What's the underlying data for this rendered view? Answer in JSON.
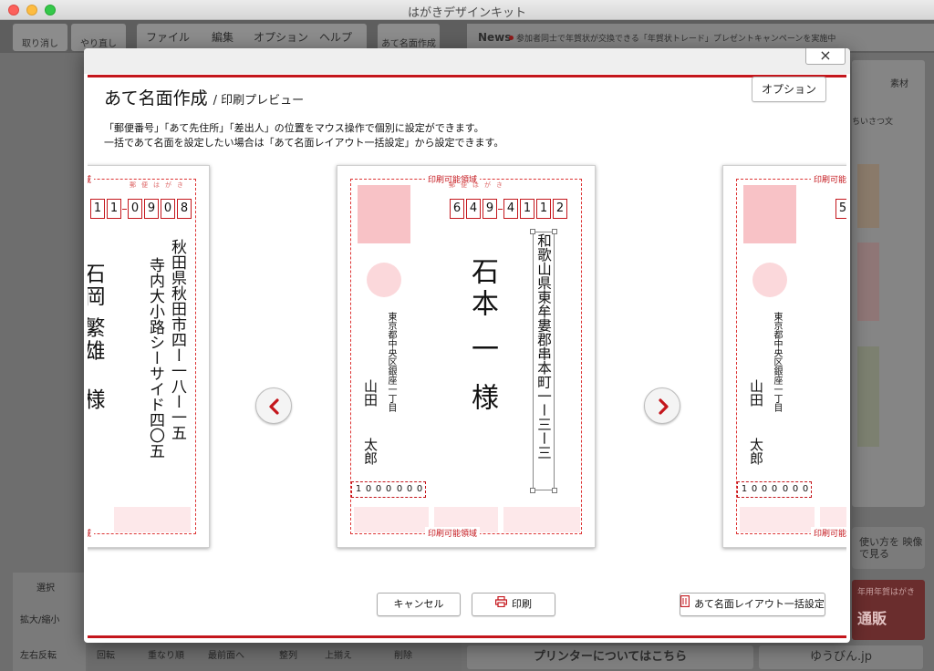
{
  "window": {
    "title": "はがきデザインキット"
  },
  "background": {
    "undo": "取り消し",
    "redo": "やり直し",
    "menu": [
      "ファイル",
      "編集",
      "オプション",
      "ヘルプ"
    ],
    "addr_btn": "あて名面作成",
    "news_label": "News",
    "news_text": "参加者同士で年賀状が交換できる「年賀状トレード」プレゼントキャンペーンを実施中",
    "right_tab": "素材",
    "right_field": "ちいさつ文",
    "cta": "使い方を 映像で見る",
    "ad_text": "年用年賀はがき",
    "ad_big": "通販",
    "select_label": "選択",
    "zoom_label": "拡大/縮小",
    "flip_label": "左右反転",
    "rotate_label": "回転",
    "order_label": "重なり順",
    "front_label": "最前面へ",
    "align_label": "整列",
    "top_align_label": "上揃え",
    "delete_label": "削除",
    "printer_link": "プリンターについてはこちら",
    "yubin": "ゆうびん.jp"
  },
  "dialog": {
    "title": "あて名面作成",
    "subtitle": "/ 印刷プレビュー",
    "option_label": "オプション",
    "desc1": "「郵便番号」「あて先住所」「差出人」の位置をマウス操作で個別に設定ができます。",
    "desc2": "一括であて名面を設定したい場合は「あて名面レイアウト一括設定」から設定できます。",
    "printable_label": "印刷可能領域",
    "hagaki_label": "郵便はがき",
    "close_label": "×",
    "cancel_label": "キャンセル",
    "print_label": "印刷",
    "layout_label": "あて名面レイアウト一括設定"
  },
  "cards": {
    "left": {
      "zip": [
        "1",
        "1",
        "0",
        "9",
        "0",
        "8"
      ],
      "addr1": "秋田県秋田市四ー一八ー一五",
      "addr2": "寺内大小路シーサイド四〇五",
      "name": "石岡 繁雄",
      "sama": "様"
    },
    "center": {
      "zip": [
        "6",
        "4",
        "9",
        "4",
        "1",
        "1",
        "2"
      ],
      "addr": "和歌山県東牟婁郡串本町一ー三ー三",
      "name": "石本 一",
      "sama": "様",
      "sender_addr": "東京都中央区銀座一丁目",
      "sender_name1": "山田",
      "sender_name2": "太郎",
      "sender_zip": [
        "1",
        "0",
        "0",
        "0",
        "0",
        "0",
        "0"
      ]
    },
    "right": {
      "zip": [
        "5"
      ],
      "sender_addr": "東京都中央区銀座一丁目",
      "sender_name1": "山田",
      "sender_name2": "太郎",
      "sender_zip": [
        "1",
        "0",
        "0",
        "0",
        "0",
        "0",
        "0"
      ]
    }
  },
  "colors": {
    "accent": "#c4161c",
    "stamp": "#f8c2c6",
    "circle": "#fbd8db"
  },
  "icons": [
    "close-icon",
    "chevron-left-icon",
    "chevron-right-icon",
    "printer-icon",
    "layout-icon"
  ]
}
